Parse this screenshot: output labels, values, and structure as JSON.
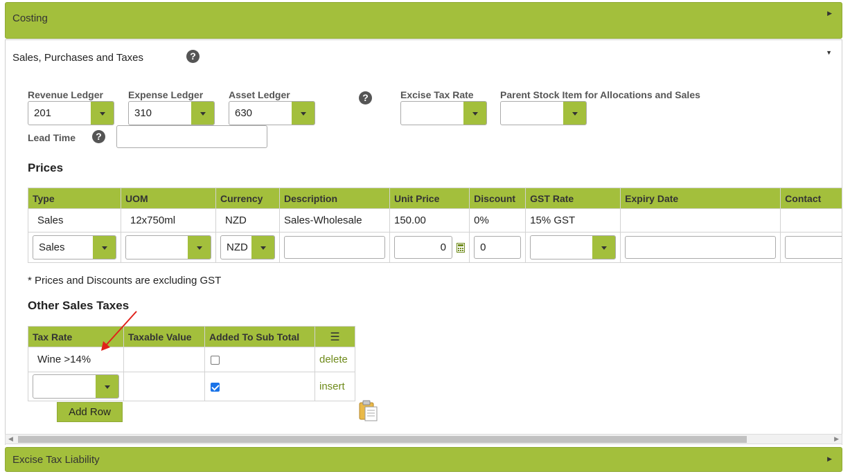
{
  "accordions": {
    "costing": {
      "title": "Costing"
    },
    "sales": {
      "title": "Sales, Purchases and Taxes"
    },
    "excise": {
      "title": "Excise Tax Liability"
    }
  },
  "fields": {
    "revenue_ledger": {
      "label": "Revenue Ledger",
      "value": "201"
    },
    "expense_ledger": {
      "label": "Expense Ledger",
      "value": "310"
    },
    "asset_ledger": {
      "label": "Asset Ledger",
      "value": "630"
    },
    "excise_tax_rate": {
      "label": "Excise Tax Rate",
      "value": ""
    },
    "parent_stock_item": {
      "label": "Parent Stock Item for Allocations and Sales",
      "value": ""
    },
    "lead_time": {
      "label": "Lead Time",
      "value": ""
    }
  },
  "prices": {
    "title": "Prices",
    "columns": [
      "Type",
      "UOM",
      "Currency",
      "Description",
      "Unit Price",
      "Discount",
      "GST Rate",
      "Expiry Date",
      "Contact"
    ],
    "rows": [
      [
        "Sales",
        "12x750ml",
        "NZD",
        "Sales-Wholesale",
        "150.00",
        "0%",
        "15% GST",
        "",
        ""
      ]
    ],
    "new_row": {
      "type": "Sales",
      "uom": "",
      "currency": "NZD",
      "description": "",
      "unit_price": "0",
      "discount": "0",
      "gst_rate": "",
      "expiry_date": "",
      "contact": ""
    },
    "note": "* Prices and Discounts are excluding GST"
  },
  "other_taxes": {
    "title": "Other Sales Taxes",
    "columns": [
      "Tax Rate",
      "Taxable Value",
      "Added To Sub Total"
    ],
    "rows": [
      {
        "tax_rate": "Wine >14%",
        "taxable_value": "",
        "added": false,
        "action": "delete"
      }
    ],
    "new_row": {
      "tax_rate": "",
      "taxable_value": "",
      "added": true,
      "action": "insert"
    },
    "add_row_label": "Add Row"
  },
  "icons": {
    "help": "?",
    "menu": "☰",
    "calculator": "calculator-icon",
    "clipboard": "clipboard-icon"
  },
  "colors": {
    "accent": "#a3bf3c",
    "link": "#6e8a1a",
    "annotation_arrow": "#e0221b"
  }
}
